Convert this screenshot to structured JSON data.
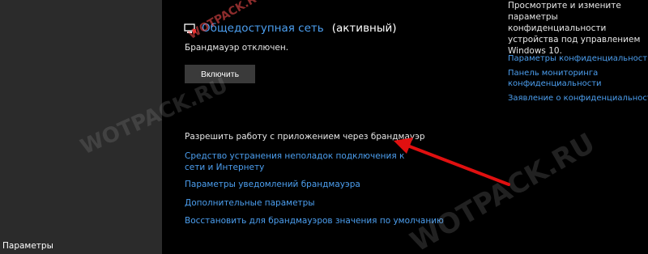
{
  "left_panel": {
    "title": "Параметры"
  },
  "network": {
    "icon": "network-shield-icon",
    "name": "Общедоступная сеть",
    "status": "(активный)",
    "firewall_status": "Брандмауэр отключен.",
    "enable_button": "Включить"
  },
  "links": {
    "allow_app": "Разрешить работу с приложением через брандмауэр",
    "troubleshoot": "Средство устранения неполадок подключения к сети и Интернету",
    "notifications": "Параметры уведомлений брандмауэра",
    "advanced": "Дополнительные параметры",
    "restore_defaults": "Восстановить для брандмауэров значения по умолчанию"
  },
  "privacy": {
    "description": "Просмотрите и измените параметры конфиденциальности устройства под управлением Windows 10.",
    "settings_link": "Параметры конфиденциальности",
    "dashboard_link": "Панель мониторинга конфиденциальности",
    "statement_link": "Заявление о конфиденциальности"
  },
  "watermarks": {
    "text_1": "WOTPACK.RU",
    "text_2": "WOTPACK.RU",
    "text_3": "WOTPACK.RU"
  },
  "colors": {
    "link": "#4c9ff0",
    "background": "#000000",
    "left_panel": "#2b2b2b",
    "button": "#3a3a3a",
    "annotation_arrow": "#e01010"
  }
}
